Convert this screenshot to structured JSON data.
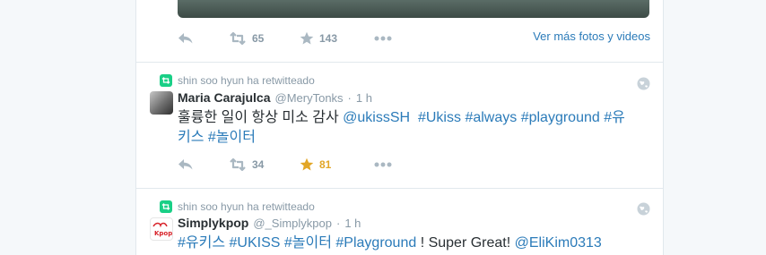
{
  "previous_tweet": {
    "retweet_count": "65",
    "favorite_count": "143",
    "more_media_link": "Ver más fotos y videos"
  },
  "tweets": [
    {
      "context": "shin soo hyun ha retwitteado",
      "fullname": "Maria Carajulca",
      "username": "@MeryTonks",
      "dot": "·",
      "time": "1 h",
      "text_line1": [
        {
          "t": "훌륭한 일이 항상 미소 감사 ",
          "link": false
        },
        {
          "t": "@ukissSH",
          "link": true
        },
        {
          "t": "  ",
          "link": false
        },
        {
          "t": "#Ukiss",
          "link": true
        },
        {
          "t": " ",
          "link": false
        },
        {
          "t": "#always",
          "link": true
        },
        {
          "t": " ",
          "link": false
        },
        {
          "t": "#playground",
          "link": true
        },
        {
          "t": " ",
          "link": false
        },
        {
          "t": "#유",
          "link": true
        }
      ],
      "text_line2": [
        {
          "t": "키스",
          "link": true
        },
        {
          "t": " ",
          "link": false
        },
        {
          "t": "#놀이터",
          "link": true
        }
      ],
      "retweet_count": "34",
      "favorite_count": "81",
      "favorited": true
    },
    {
      "context": "shin soo hyun ha retwitteado",
      "fullname": "Simplykpop",
      "username": "@_Simplykpop",
      "dot": "·",
      "time": "1 h",
      "avatar_text": "Kpop",
      "text_line1": [
        {
          "t": "#유키스",
          "link": true
        },
        {
          "t": " ",
          "link": false
        },
        {
          "t": "#UKISS",
          "link": true
        },
        {
          "t": " ",
          "link": false
        },
        {
          "t": "#놀이터",
          "link": true
        },
        {
          "t": " ",
          "link": false
        },
        {
          "t": "#Playground",
          "link": true
        },
        {
          "t": " ! Super Great! ",
          "link": false
        },
        {
          "t": "@EliKim0313",
          "link": true
        }
      ]
    }
  ],
  "colors": {
    "link": "#2b7bb9",
    "muted": "#8899a6",
    "text": "#292f33",
    "retweet_green": "#19cf86",
    "favorite_gold": "#e2a627",
    "divider": "#e1e8ed"
  },
  "icons": {
    "reply": "reply-icon",
    "retweet": "retweet-icon",
    "favorite": "star-icon",
    "more": "more-dots-icon",
    "globe": "globe-icon"
  }
}
